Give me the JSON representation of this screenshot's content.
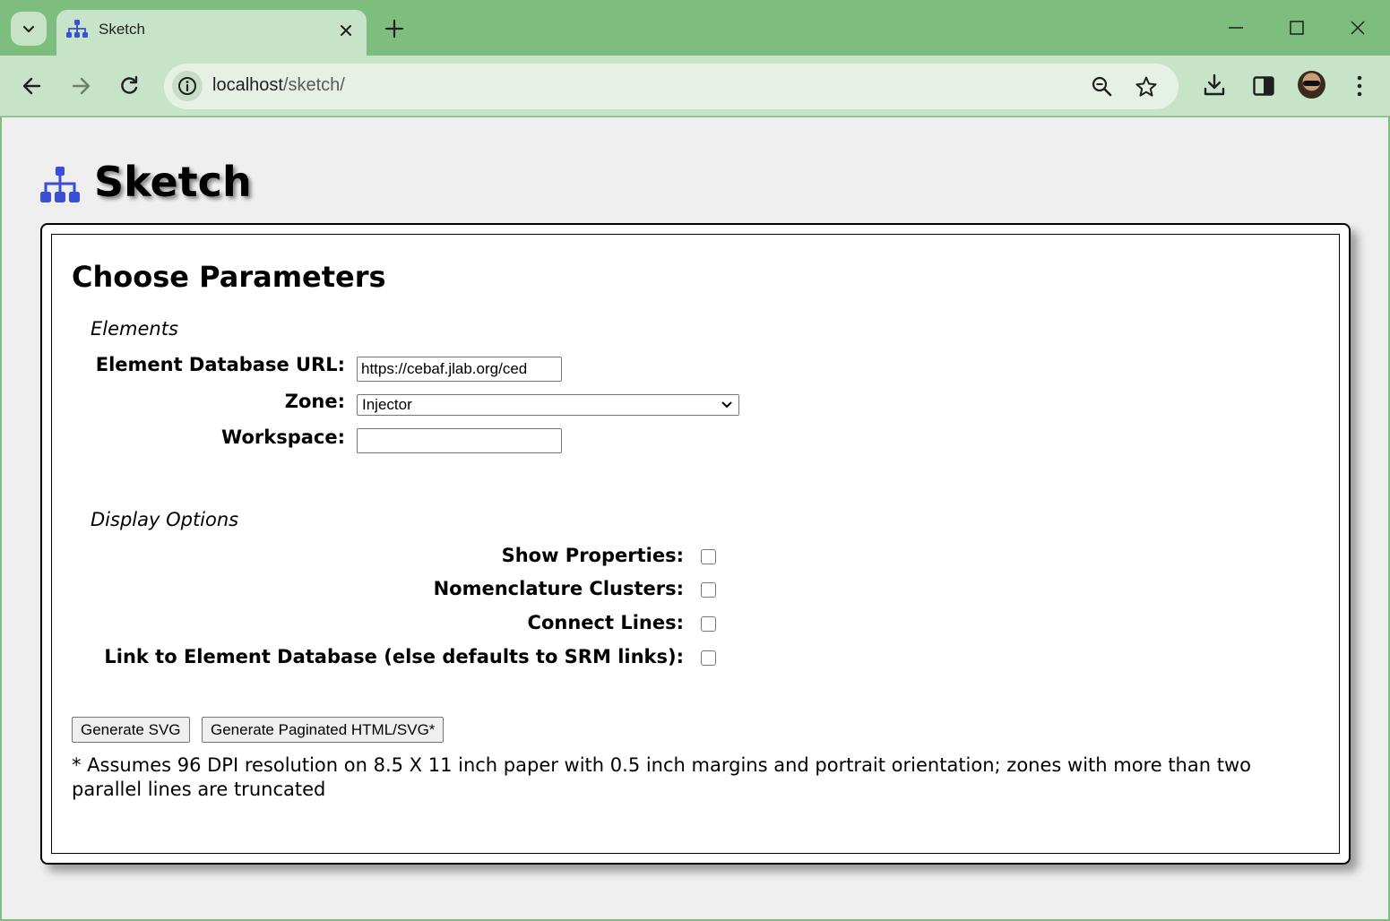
{
  "browser": {
    "tab": {
      "title": "Sketch"
    },
    "url": {
      "host": "localhost",
      "path": "/sketch/"
    }
  },
  "page": {
    "title": "Sketch",
    "form": {
      "title": "Choose Parameters",
      "elements_section": {
        "legend": "Elements",
        "db_url_label": "Element Database URL:",
        "db_url_value": "https://cebaf.jlab.org/ced",
        "zone_label": "Zone:",
        "zone_selected": "Injector",
        "workspace_label": "Workspace:",
        "workspace_value": ""
      },
      "display_section": {
        "legend": "Display Options",
        "show_properties_label": "Show Properties:",
        "nomenclature_label": "Nomenclature Clusters:",
        "connect_lines_label": "Connect Lines:",
        "link_db_label": "Link to Element Database (else defaults to SRM links):"
      },
      "buttons": {
        "generate_svg": "Generate SVG",
        "generate_paginated": "Generate Paginated HTML/SVG*"
      },
      "footnote": "* Assumes 96 DPI resolution on 8.5 X 11 inch paper with 0.5 inch margins and portrait orientation; zones with more than two parallel lines are truncated"
    }
  },
  "colors": {
    "chrome_frame": "#7dbd7d",
    "chrome_toolbar": "#c8e4c8",
    "logo_blue": "#3b4ed8"
  }
}
